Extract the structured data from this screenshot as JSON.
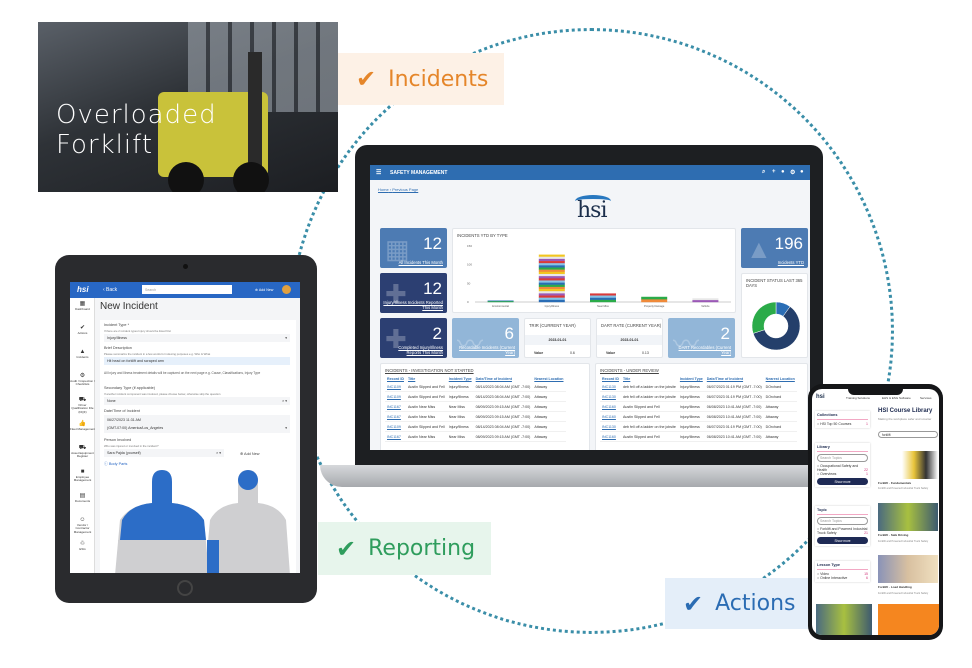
{
  "photo": {
    "caption_line1": "Overloaded",
    "caption_line2": "Forklift"
  },
  "badges": {
    "incidents": {
      "label": "Incidents",
      "color": "#e5862a"
    },
    "reporting": {
      "label": "Reporting",
      "color": "#2f9d5d"
    },
    "actions": {
      "label": "Actions",
      "color": "#2b6cb3"
    }
  },
  "laptop": {
    "app_title": "SAFETY MANAGEMENT",
    "header_icons": [
      "search-icon",
      "plus-icon",
      "help-icon",
      "gear-icon",
      "user-icon"
    ],
    "breadcrumb": [
      "Home",
      "Previous Page"
    ],
    "logo_text": "hsi",
    "tiles": {
      "all_incidents": {
        "value": "12",
        "label": "All Incidents This Month"
      },
      "injury_reported": {
        "value": "12",
        "label": "Injury/Illness Incidents Reported This Month"
      },
      "completed": {
        "value": "2",
        "label": "Completed Injury/Illness Reports This Month"
      },
      "recordable": {
        "value": "6",
        "label": "Recordable Incidents (Current Year)"
      },
      "dart": {
        "value": "2",
        "label": "DART Recordables (Current Year)"
      },
      "ytd": {
        "value": "196",
        "label": "Incidents YTD"
      }
    },
    "chart": {
      "title": "INCIDENTS YTD BY TYPE",
      "yticks": [
        "0",
        "50",
        "100",
        "150"
      ],
      "categories": [
        "Environmental",
        "Injury/Illness",
        "Near Miss",
        "Property Damage",
        "Vehicle"
      ],
      "values": [
        4,
        127,
        23,
        14,
        10
      ]
    },
    "trir": {
      "title": "TRIR (CURRENT YEAR)",
      "date": "2023-01-01",
      "value_label": "Value",
      "value": "0.6"
    },
    "dart_rate": {
      "title": "DART RATE (CURRENT YEAR)",
      "date": "2023-01-01",
      "value_label": "Value",
      "value": "0.13"
    },
    "donut": {
      "title": "INCIDENT STATUS LAST 365 DAYS",
      "segments": [
        {
          "color": "#2a6db5",
          "share": 0.1
        },
        {
          "color": "#243f6b",
          "share": 0.6
        },
        {
          "color": "#2bab49",
          "share": 0.3
        }
      ]
    },
    "table_left": {
      "title": "INCIDENTS - INVESTIGATION NOT STARTED",
      "columns": [
        "Record ID",
        "Title",
        "Incident Type",
        "Date/Time of Incident",
        "Nearest Location"
      ],
      "rows": [
        [
          "INC1109",
          "Austin Slipped and Fell",
          "Injury/Illness",
          "08/14/2023 08:04 AM (GMT -7:00)",
          "Attaway"
        ],
        [
          "INC1109",
          "Austin Slipped and Fell",
          "Injury/Illness",
          "08/14/2023 08:04 AM (GMT -7:00)",
          "Attaway"
        ],
        [
          "INC1167",
          "Austin Near Miss",
          "Near Miss",
          "08/09/2023 09:15 AM (GMT -7:00)",
          "Attaway"
        ],
        [
          "INC1167",
          "Austin Near Miss",
          "Near Miss",
          "08/09/2023 09:15 AM (GMT -7:00)",
          "Attaway"
        ],
        [
          "INC1109",
          "Austin Slipped and Fell",
          "Injury/Illness",
          "08/14/2023 08:04 AM (GMT -7:00)",
          "Attaway"
        ],
        [
          "INC1167",
          "Austin Near Miss",
          "Near Miss",
          "08/09/2023 09:15 AM (GMT -7:00)",
          "Attaway"
        ]
      ]
    },
    "table_right": {
      "title": "INCIDENTS - UNDER REVIEW",
      "columns": [
        "Record ID",
        "Title",
        "Incident Type",
        "Date/Time of Incident",
        "Nearest Location"
      ],
      "rows": [
        [
          "INC1130",
          "deb fell off a ladder on the jobsite",
          "Injury/Illness",
          "06/07/2023 01:19 PM (GMT -7:00)",
          "DOrchard"
        ],
        [
          "INC1130",
          "deb fell off a ladder on the jobsite",
          "Injury/Illness",
          "06/07/2023 01:19 PM (GMT -7:00)",
          "DOrchard"
        ],
        [
          "INC1160",
          "Austin Slipped and Fell",
          "Injury/Illness",
          "06/08/2023 10:41 AM (GMT -7:00)",
          "Attaway"
        ],
        [
          "INC1160",
          "Austin Slipped and Fell",
          "Injury/Illness",
          "06/08/2023 10:41 AM (GMT -7:00)",
          "Attaway"
        ],
        [
          "INC1130",
          "deb fell off a ladder on the jobsite",
          "Injury/Illness",
          "06/07/2023 01:19 PM (GMT -7:00)",
          "DOrchard"
        ],
        [
          "INC1160",
          "Austin Slipped and Fell",
          "Injury/Illness",
          "06/08/2023 10:41 AM (GMT -7:00)",
          "Attaway"
        ]
      ]
    }
  },
  "tablet": {
    "logo_text": "hsi",
    "back_label": "‹ Back",
    "search_placeholder": "Search",
    "add_new_label": "Add New",
    "sidebar": [
      "Dashboard",
      "Actions",
      "Incidents",
      "Audit / Inspection / Checklists",
      "Driver Qualification File (DQF)",
      "Fleet Management",
      "Asset Equipment Register",
      "Employee Management",
      "Documents",
      "Vendor / Contractor Management",
      "ESG"
    ],
    "page_title": "New Incident",
    "form": {
      "incident_type_label": "Incident Type *",
      "incident_type_help": "If there are 2 incident types Injury should be listed first",
      "incident_type_value": "Injury/Illness",
      "brief_label": "Brief Description",
      "brief_help": "Please summarize the incident in a few words for indexing purposes e.g. Who & What",
      "brief_value": "Hit head on forklift and scraped arm",
      "note": "All Injury and Illness treatment details will be captured on the next page e.g. Cause, Classifications, Injury Type",
      "secondary_label": "Secondary Type (if applicable)",
      "secondary_help": "If another incident component was involved, please choose below, otherwise skip the question",
      "secondary_value": "None",
      "datetime_label": "Date/Time of Incident",
      "datetime_value": "06/27/2023 11:31 AM",
      "timezone_value": "(GMT-07:00) America/Los_Angeles",
      "person_label": "Person Involved",
      "person_help": "Who was injured or involved in the incident?",
      "person_value": "Sara Pajda (yourself)",
      "person_add": "Add New",
      "body_parts_label": "Body Parts"
    }
  },
  "phone": {
    "nav": [
      "Training Solutions",
      "EHS & ESG Software",
      "Services"
    ],
    "title": "HSI Course Library",
    "subtitle": "Making the workplace safer and smarter",
    "search_value": "forklift",
    "collections": {
      "title": "Collections",
      "items": [
        {
          "label": "HSI Top 50 Courses",
          "count": "1"
        }
      ]
    },
    "library": {
      "title": "Library",
      "search_placeholder": "Search Topics",
      "items": [
        {
          "label": "Occupational Safety and Health",
          "count": "22"
        },
        {
          "label": "Overviews",
          "count": "1"
        }
      ],
      "button": "Show more"
    },
    "topic": {
      "title": "Topic",
      "search_placeholder": "Search Topics",
      "items": [
        {
          "label": "Forklift and Powered Industrial Truck Safety",
          "count": "21"
        }
      ],
      "button": "Show more"
    },
    "lesson_type": {
      "title": "Lesson Type",
      "items": [
        {
          "label": "Video",
          "count": "15"
        },
        {
          "label": "Online Interactive",
          "count": "6"
        }
      ]
    },
    "courses": [
      {
        "title": "Forklift - Fundamentals",
        "sub": "Forklift and Powered Industrial Truck Safety"
      },
      {
        "title": "Forklift - Safe Driving",
        "sub": "Forklift and Powered Industrial Truck Safety"
      },
      {
        "title": "Forklift - Load Handling",
        "sub": "Forklift and Powered Industrial Truck Safety"
      }
    ]
  }
}
